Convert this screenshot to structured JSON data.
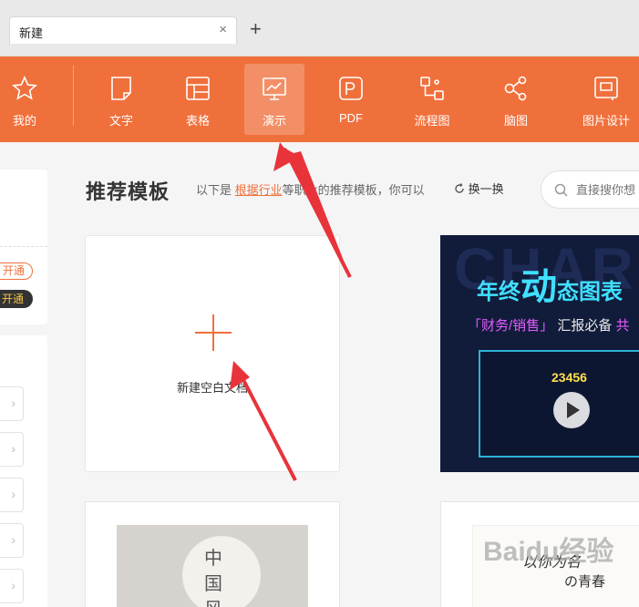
{
  "tabs": {
    "active_label": "新建",
    "close": "×",
    "add": "+"
  },
  "toolbar": {
    "items": [
      {
        "label": "我的",
        "icon": "star-icon"
      },
      {
        "label": "文字",
        "icon": "document-icon"
      },
      {
        "label": "表格",
        "icon": "table-icon"
      },
      {
        "label": "演示",
        "icon": "presentation-icon",
        "active": true
      },
      {
        "label": "PDF",
        "icon": "pdf-icon"
      },
      {
        "label": "流程图",
        "icon": "flowchart-icon"
      },
      {
        "label": "脑图",
        "icon": "mindmap-icon"
      },
      {
        "label": "图片设计",
        "icon": "image-design-icon"
      }
    ],
    "color": "#f0703c"
  },
  "sidebar": {
    "pill_outline": "开通",
    "pill_dark": "开通",
    "chevron": "›"
  },
  "main": {
    "title": "推荐模板",
    "desc_prefix": "以下是",
    "desc_link": "根据行业",
    "desc_suffix": "等职业的推荐模板，你可以",
    "refresh": "换一换",
    "search_placeholder": "直接搜你想"
  },
  "cards": {
    "blank_label": "新建空白文档",
    "dash": {
      "bg_text": "CHAR",
      "title_a": "年终",
      "title_big": "动",
      "title_b": "态图表",
      "sub_a": "「财务/销售」",
      "sub_b": "汇报必备",
      "sub_c": "共",
      "number": "23456"
    },
    "bottom_left_text": "中国风",
    "bottom_right_text1": "以你为名",
    "bottom_right_text2": "の青春"
  },
  "watermark": "Baidu经验"
}
